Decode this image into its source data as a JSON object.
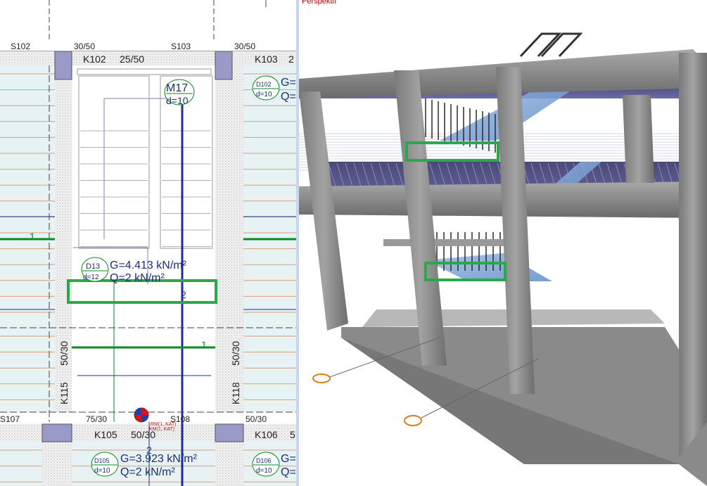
{
  "plan": {
    "slab_labels": {
      "s102": "S102",
      "s103": "S103",
      "s107": "S107",
      "s108": "S108"
    },
    "beams": {
      "k102": "K102",
      "k102_size": "25/50",
      "k103": "K103",
      "k103_suffix": "2",
      "k105": "K105",
      "k105_size": "50/30",
      "k106": "K106",
      "k106_suffix": "5",
      "k115": "K115",
      "k118": "K118"
    },
    "column_sizes": {
      "c1": "30/50",
      "c2": "30/50",
      "c3": "75/30",
      "c4": "50/30"
    },
    "vertical_sizes": {
      "left": "50/30",
      "right": "50/30"
    },
    "stair": {
      "name": "M17",
      "thickness": "d=10"
    },
    "slabs": {
      "d13": {
        "name": "D13",
        "thickness": "d=12",
        "g": "G=4.413 kN/m²",
        "q": "Q=2 kN/m²"
      },
      "d102": {
        "name": "D102",
        "thickness": "d=10",
        "g": "G=",
        "q": "Q="
      },
      "d105": {
        "name": "D105",
        "thickness": "d=10",
        "g": "G=3.923 kN/m²",
        "q": "Q=2 kN/m²"
      },
      "d106": {
        "name": "D106",
        "thickness": "d=10",
        "g": "G=",
        "q": "Q="
      }
    },
    "axis_labels": {
      "a1_left": "1",
      "a1_right": "1",
      "a2_top": "2",
      "a2_bottom": "2"
    },
    "marker_text": {
      "line1": "RM(1, KAT)",
      "line2": "KM(1, KAT)"
    }
  },
  "perspective": {
    "title": "Perspektif"
  },
  "colors": {
    "highlight": "#2aa84a",
    "hatch": "#d9d9d9",
    "column_fill": "#9a9ac8",
    "slab_fill": "#e6f2f4",
    "slab_line": "#d9a07a",
    "axis_blue": "#1c2e9c",
    "axis_green": "#0a8a1e",
    "sky": "#ffffff",
    "concrete": "#8c8c8c"
  }
}
